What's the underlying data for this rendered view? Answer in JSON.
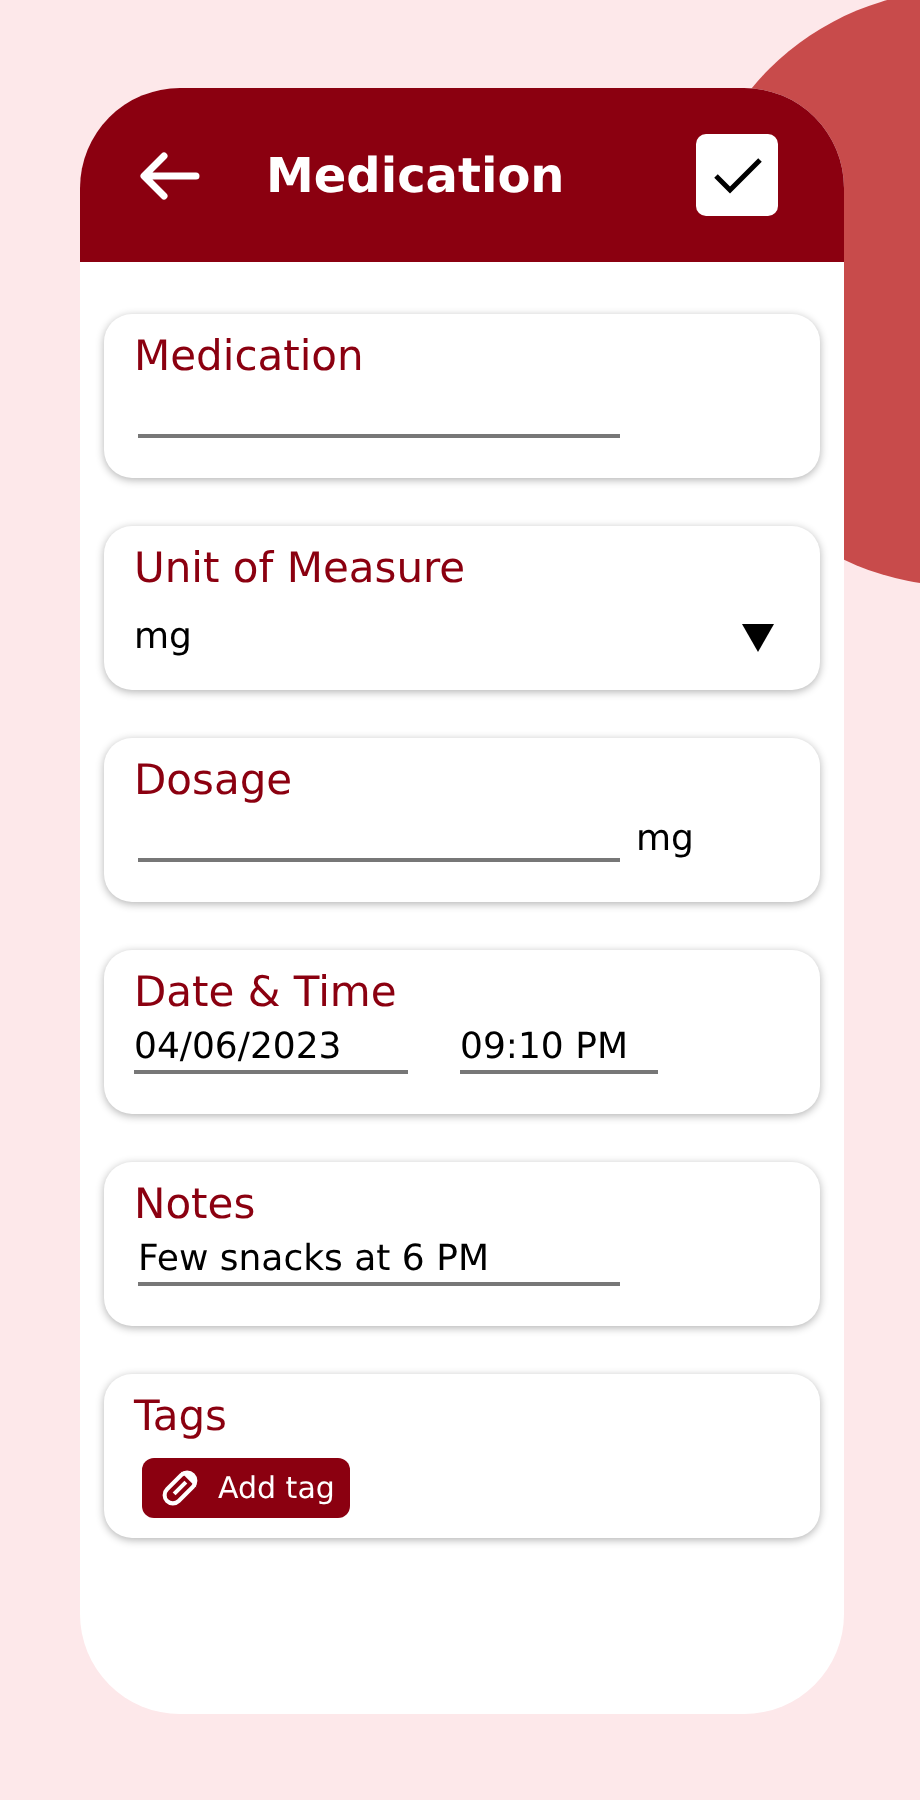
{
  "header": {
    "title": "Medication"
  },
  "fields": [
    {
      "kind": "text",
      "label": "Medication"
    },
    {
      "kind": "select",
      "label": "Unit of Measure",
      "value": "mg"
    },
    {
      "kind": "suffix",
      "label": "Dosage",
      "suffix": "mg"
    },
    {
      "kind": "datetime",
      "label": "Date & Time",
      "date": "04/06/2023",
      "time": "09:10 PM"
    },
    {
      "kind": "text",
      "label": "Notes",
      "value": "Few snacks at 6 PM"
    },
    {
      "kind": "tags",
      "label": "Tags",
      "button": "Add tag"
    }
  ]
}
